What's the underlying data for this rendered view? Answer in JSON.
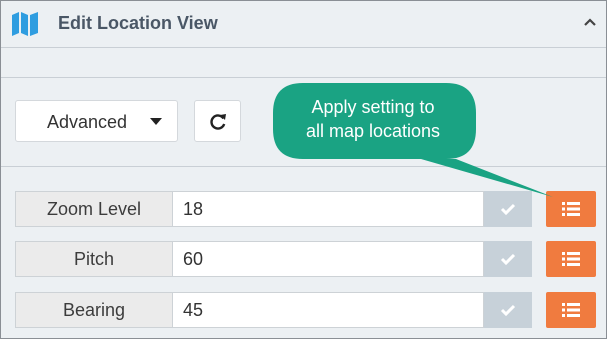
{
  "header": {
    "title": "Edit Location View",
    "icon": "map-icon",
    "collapse_icon": "chevron-up-icon"
  },
  "toolbar": {
    "mode_selected": "Advanced",
    "refresh_icon": "refresh-icon"
  },
  "callout": {
    "lines": [
      "Apply setting to",
      "all map locations"
    ],
    "color": "#1aa383"
  },
  "settings": [
    {
      "label": "Zoom Level",
      "value": "18"
    },
    {
      "label": "Pitch",
      "value": "60"
    },
    {
      "label": "Bearing",
      "value": "45"
    }
  ],
  "colors": {
    "accent_orange": "#f07b3f",
    "check_gray": "#c7d1d9",
    "map_icon_blue": "#2f9de0"
  }
}
